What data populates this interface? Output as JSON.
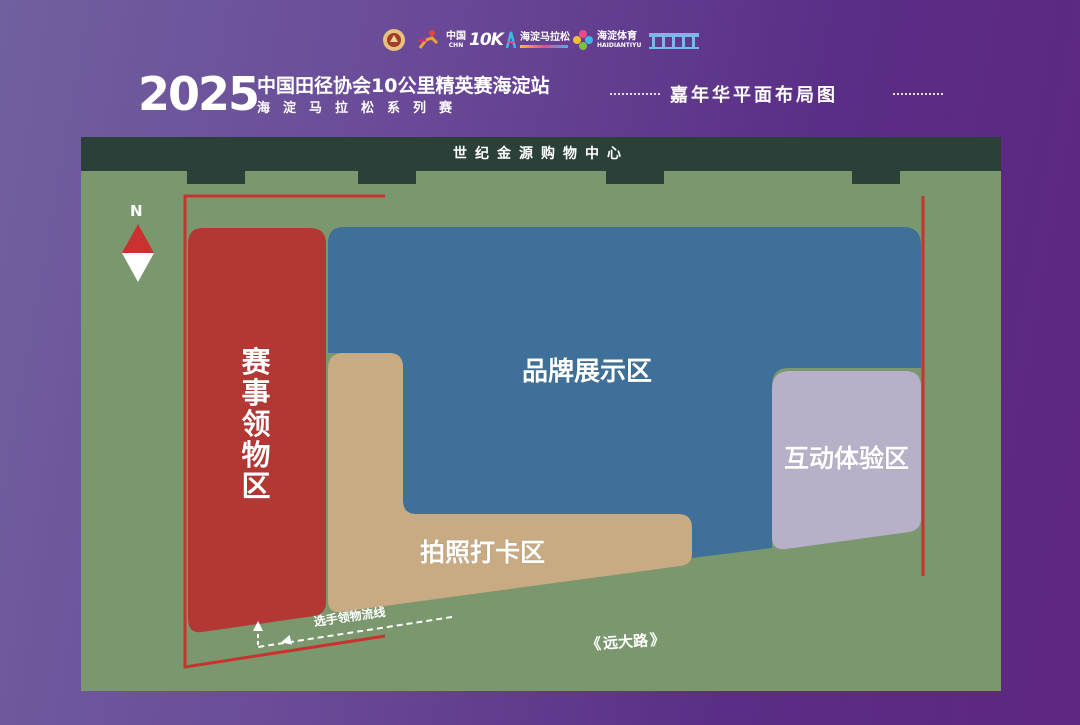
{
  "logos": [
    {
      "name": "athletics-emblem-logo"
    },
    {
      "name": "running-figure-logo"
    },
    {
      "name": "china-10k-logo",
      "text_a": "中国",
      "text_b": "10K",
      "text_c": "CHN"
    },
    {
      "name": "haidian-marathon-logo",
      "text": "海淀马拉松"
    },
    {
      "name": "haidian-sports-logo",
      "text_a": "海淀体育",
      "text_b": "HAIDIANTIYU"
    },
    {
      "name": "building-skyline-logo"
    }
  ],
  "header": {
    "year": "2025",
    "title_line1": "中国田径协会10公里精英赛海淀站",
    "title_line2": "海淀马拉松系列赛",
    "subtitle": "嘉年华平面布局图"
  },
  "map": {
    "top_building_label": "世纪金源购物中心",
    "compass_label": "N",
    "zones": {
      "event_pickup": "赛事领物区",
      "brand_display": "品牌展示区",
      "interactive": "互动体验区",
      "photo_checkin": "拍照打卡区"
    },
    "flow_line_label": "选手领物流线",
    "road_label": "远大路",
    "road_arrows": {
      "left": "《",
      "right": "》"
    }
  },
  "colors": {
    "ground": "#7b976e",
    "building": "#2c403a",
    "event_pickup": "#b33733",
    "brand_display": "#3e7099",
    "interactive": "#b8b0c8",
    "photo_checkin": "#c8aa83",
    "fence": "#c9322e"
  }
}
